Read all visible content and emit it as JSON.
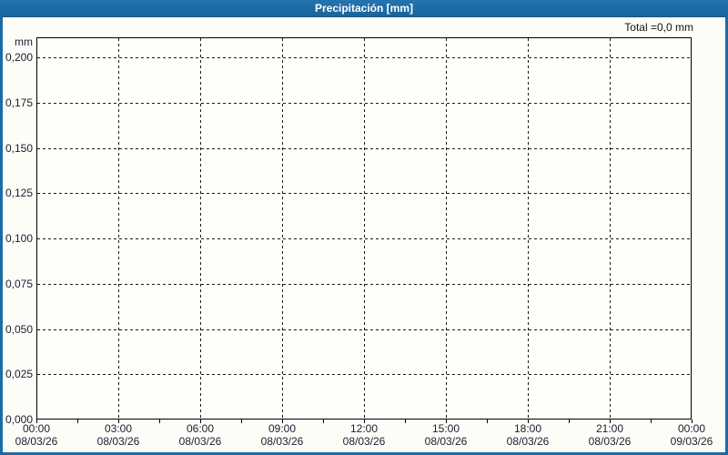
{
  "widget": {
    "title": "Precipitación [mm]",
    "total_label": "Total =0,0 mm",
    "accent_color": "#1d6ba5",
    "plot_border_color": "#000000",
    "grid_color": "#1a1a1a"
  },
  "chart_data": {
    "type": "bar",
    "title": "Precipitación [mm]",
    "ylabel": "mm",
    "xlabel": "",
    "total_annotation": "Total =0,0 mm",
    "ylim": [
      0,
      0.211
    ],
    "grid": "dashed",
    "legend_position": "none",
    "y_axis": {
      "unit_label": "mm",
      "tick_values": [
        0.2,
        0.175,
        0.15,
        0.125,
        0.1,
        0.075,
        0.05,
        0.025,
        0.0
      ],
      "tick_labels": [
        "0,200",
        "0,175",
        "0,150",
        "0,125",
        "0,100",
        "0,075",
        "0,050",
        "0,025",
        "0,000"
      ]
    },
    "x_axis": {
      "tick_labels": [
        {
          "time": "00:00",
          "date": "08/03/26"
        },
        {
          "time": "03:00",
          "date": "08/03/26"
        },
        {
          "time": "06:00",
          "date": "08/03/26"
        },
        {
          "time": "09:00",
          "date": "08/03/26"
        },
        {
          "time": "12:00",
          "date": "08/03/26"
        },
        {
          "time": "15:00",
          "date": "08/03/26"
        },
        {
          "time": "18:00",
          "date": "08/03/26"
        },
        {
          "time": "21:00",
          "date": "08/03/26"
        },
        {
          "time": "00:00",
          "date": "09/03/26"
        }
      ],
      "minor_ticks_between_majors": 1
    },
    "series": [
      {
        "name": "Precipitación",
        "values": [
          0,
          0,
          0,
          0,
          0,
          0,
          0,
          0,
          0
        ]
      }
    ]
  }
}
